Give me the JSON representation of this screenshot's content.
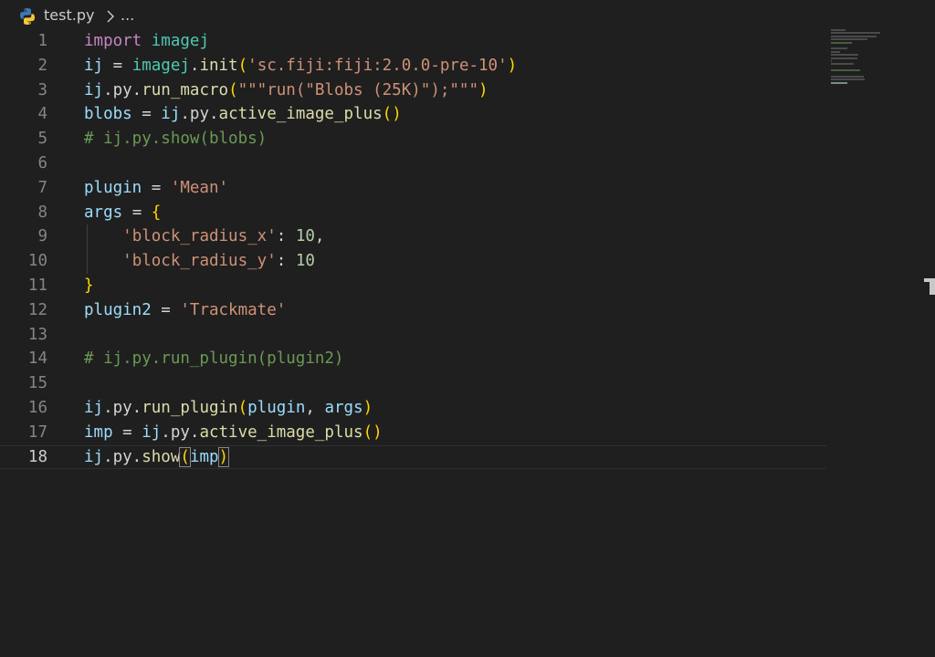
{
  "breadcrumb": {
    "file_name": "test.py",
    "ellipsis": "...",
    "file_icon": "python-icon",
    "chevron_icon": "chevron-right-icon"
  },
  "editor": {
    "active_line": 18,
    "lines": [
      {
        "num": "1",
        "tokens": [
          [
            "k",
            "import"
          ],
          [
            "p",
            " "
          ],
          [
            "m",
            "imagej"
          ]
        ]
      },
      {
        "num": "2",
        "tokens": [
          [
            "v",
            "ij"
          ],
          [
            "p",
            " = "
          ],
          [
            "m",
            "imagej"
          ],
          [
            "p",
            "."
          ],
          [
            "f",
            "init"
          ],
          [
            "br",
            "("
          ],
          [
            "s",
            "'sc.fiji:fiji:2.0.0-pre-10'"
          ],
          [
            "br",
            ")"
          ]
        ]
      },
      {
        "num": "3",
        "tokens": [
          [
            "v",
            "ij"
          ],
          [
            "p",
            ".py."
          ],
          [
            "f",
            "run_macro"
          ],
          [
            "br",
            "("
          ],
          [
            "s",
            "\"\"\"run(\"Blobs (25K)\");\"\"\""
          ],
          [
            "br",
            ")"
          ]
        ]
      },
      {
        "num": "4",
        "tokens": [
          [
            "v",
            "blobs"
          ],
          [
            "p",
            " = "
          ],
          [
            "v",
            "ij"
          ],
          [
            "p",
            ".py."
          ],
          [
            "f",
            "active_image_plus"
          ],
          [
            "br",
            "()"
          ]
        ]
      },
      {
        "num": "5",
        "tokens": [
          [
            "c",
            "# ij.py.show(blobs)"
          ]
        ]
      },
      {
        "num": "6",
        "tokens": []
      },
      {
        "num": "7",
        "tokens": [
          [
            "v",
            "plugin"
          ],
          [
            "p",
            " = "
          ],
          [
            "s",
            "'Mean'"
          ]
        ]
      },
      {
        "num": "8",
        "tokens": [
          [
            "v",
            "args"
          ],
          [
            "p",
            " = "
          ],
          [
            "br",
            "{"
          ]
        ]
      },
      {
        "num": "9",
        "tokens": [
          [
            "p",
            "    "
          ],
          [
            "s",
            "'block_radius_x'"
          ],
          [
            "p",
            ": "
          ],
          [
            "n",
            "10"
          ],
          [
            "p",
            ","
          ]
        ]
      },
      {
        "num": "10",
        "tokens": [
          [
            "p",
            "    "
          ],
          [
            "s",
            "'block_radius_y'"
          ],
          [
            "p",
            ": "
          ],
          [
            "n",
            "10"
          ]
        ]
      },
      {
        "num": "11",
        "tokens": [
          [
            "br",
            "}"
          ]
        ]
      },
      {
        "num": "12",
        "tokens": [
          [
            "v",
            "plugin2"
          ],
          [
            "p",
            " = "
          ],
          [
            "s",
            "'Trackmate'"
          ]
        ]
      },
      {
        "num": "13",
        "tokens": []
      },
      {
        "num": "14",
        "tokens": [
          [
            "c",
            "# ij.py.run_plugin(plugin2)"
          ]
        ]
      },
      {
        "num": "15",
        "tokens": []
      },
      {
        "num": "16",
        "tokens": [
          [
            "v",
            "ij"
          ],
          [
            "p",
            ".py."
          ],
          [
            "f",
            "run_plugin"
          ],
          [
            "br",
            "("
          ],
          [
            "v",
            "plugin"
          ],
          [
            "p",
            ", "
          ],
          [
            "v",
            "args"
          ],
          [
            "br",
            ")"
          ]
        ]
      },
      {
        "num": "17",
        "tokens": [
          [
            "v",
            "imp"
          ],
          [
            "p",
            " = "
          ],
          [
            "v",
            "ij"
          ],
          [
            "p",
            ".py."
          ],
          [
            "f",
            "active_image_plus"
          ],
          [
            "br",
            "()"
          ]
        ]
      },
      {
        "num": "18",
        "tokens": [
          [
            "v",
            "ij"
          ],
          [
            "p",
            ".py."
          ],
          [
            "f",
            "show"
          ],
          [
            "brh",
            "("
          ],
          [
            "v",
            "imp"
          ],
          [
            "brh",
            ")"
          ]
        ]
      }
    ]
  },
  "colors": {
    "background": "#1f1f1f",
    "keyword": "#c586c0",
    "module": "#4ec9b0",
    "variable": "#9cdcfe",
    "function": "#dcdcaa",
    "string": "#ce9178",
    "number": "#b5cea8",
    "comment": "#6a9955",
    "bracket": "#ffd700"
  }
}
